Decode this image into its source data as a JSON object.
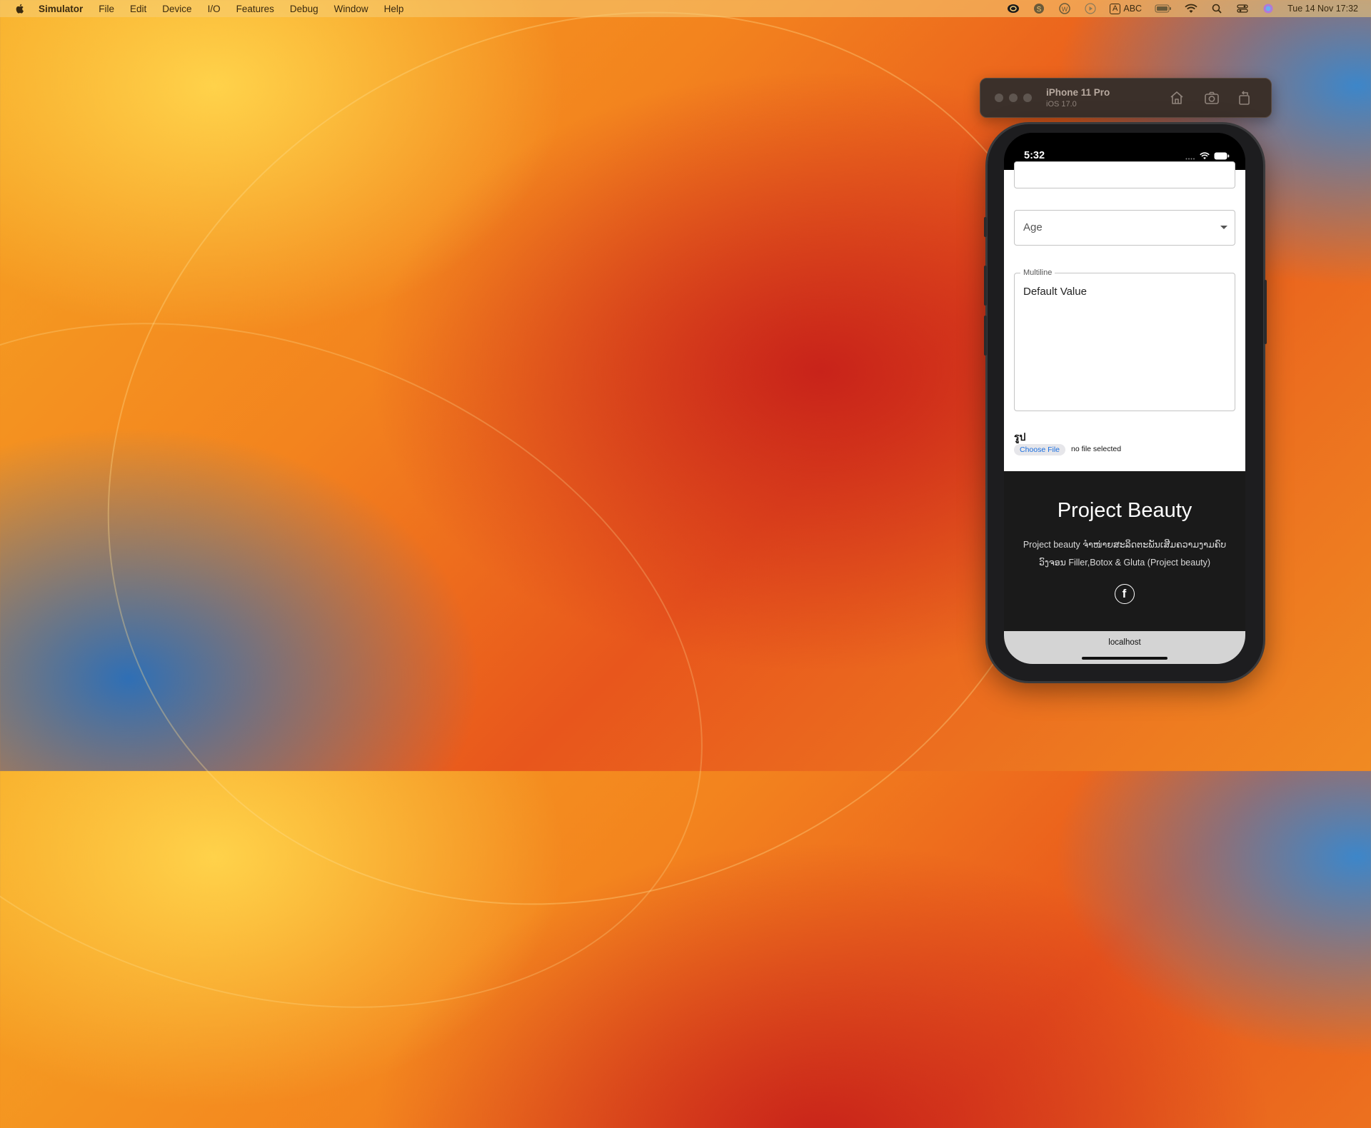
{
  "menubar": {
    "app_name": "Simulator",
    "items": [
      "File",
      "Edit",
      "Device",
      "I/O",
      "Features",
      "Debug",
      "Window",
      "Help"
    ],
    "input_label": "ABC",
    "input_badge": "A",
    "datetime": "Tue 14 Nov  17:32"
  },
  "simulator": {
    "device_name": "iPhone 11 Pro",
    "os_version": "iOS 17.0",
    "toolbar_icons": [
      "home-icon",
      "screenshot-icon",
      "rotate-icon"
    ]
  },
  "phone": {
    "status_time": "5:32",
    "form": {
      "age_select_label": "Age",
      "multiline_label": "Multiline",
      "multiline_value": "Default Value",
      "file_label": "รูป",
      "choose_file_label": "Choose File",
      "no_file_text": "no file selected"
    },
    "footer": {
      "title": "Project Beauty",
      "description": "Project beauty ຈຳໜ່າຍສະລິດຕະພັນເສີມຄວາມງາມຄົບວົງຈອນ Filler,Botox & Gluta (Project beauty)",
      "social_icon": "facebook-icon"
    },
    "address_bar": {
      "url": "localhost"
    }
  }
}
